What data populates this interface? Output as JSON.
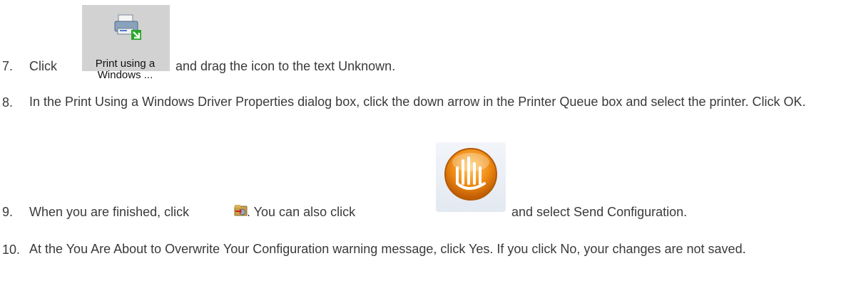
{
  "steps": [
    {
      "number": "7.",
      "before": "Click",
      "after": "and drag the icon to the text Unknown."
    },
    {
      "number": "8.",
      "text": "In the Print Using a Windows Driver Properties dialog box, click the down arrow in the Printer Queue box and select the printer. Click OK."
    },
    {
      "number": "9.",
      "part1": "When you are finished, click",
      "part2": ". You can also click",
      "part3": "and select Send Configuration."
    },
    {
      "number": "10.",
      "text": "At the You Are About to Overwrite Your Configuration warning message, click Yes. If you click No, your changes are not saved."
    }
  ],
  "tile": {
    "line1": "Print using a",
    "line2": "Windows ...",
    "icon": "printer-icon"
  },
  "icons": {
    "send_config": "send-configuration-icon",
    "app_button": "application-menu-orb-icon"
  },
  "colors": {
    "tile_bg": "#d2d2d2",
    "orb": "#f08c14",
    "text": "#3a3a3a"
  }
}
